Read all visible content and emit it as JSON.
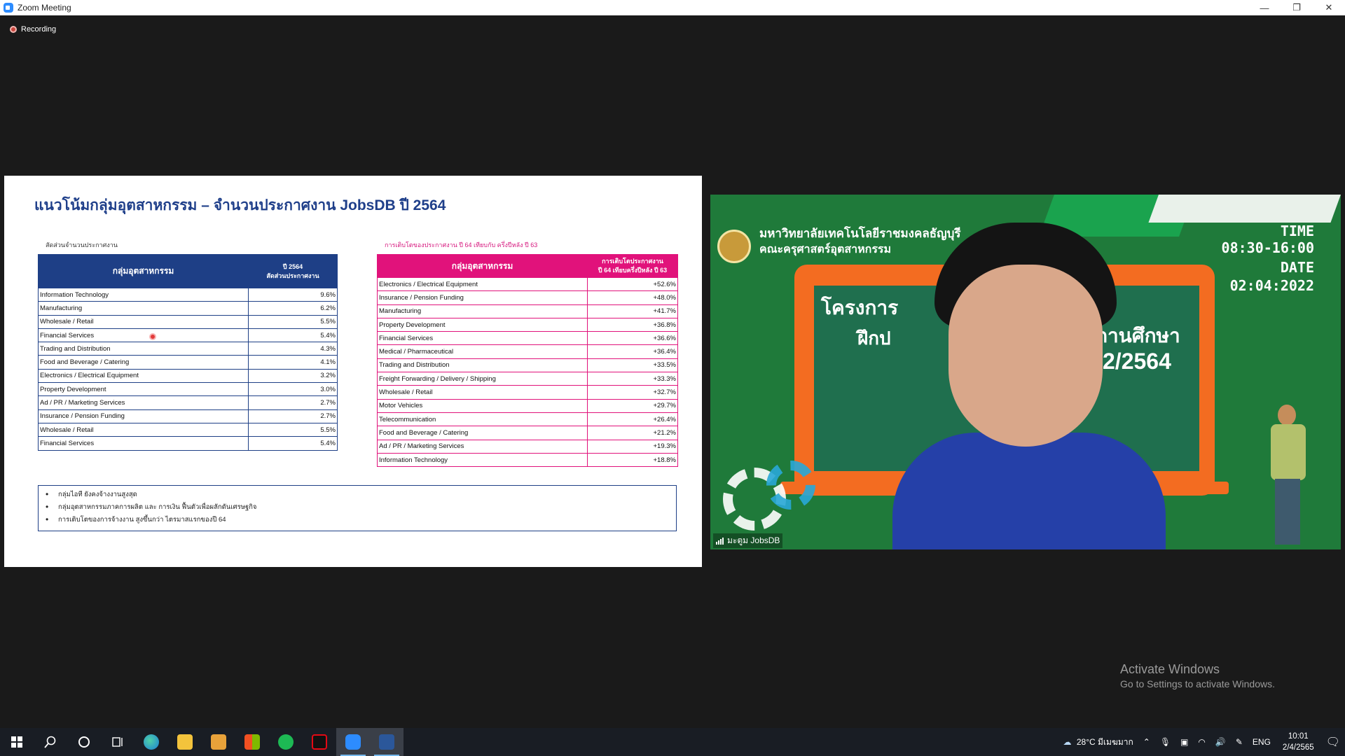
{
  "window": {
    "title": "Zoom Meeting",
    "minimize": "—",
    "maximize": "❐",
    "close": "✕"
  },
  "recording": {
    "label": "Recording"
  },
  "slide": {
    "title": "แนวโน้มกลุ่มอุตสาหกรรม – จำนวนประกาศงาน JobsDB ปี 2564",
    "left_subtitle": "สัดส่วนจำนวนประกาศงาน",
    "right_subtitle": "การเติบโตของประกาศงาน ปี 64 เทียบกับ ครึ่งปีหลัง ปี 63",
    "left_table": {
      "header_col1": "กลุ่มอุตสาหกรรม",
      "header_col2_line1": "ปี 2564",
      "header_col2_line2": "สัดส่วนประกาศงาน",
      "rows": [
        {
          "name": "Information Technology",
          "value": "9.6%"
        },
        {
          "name": "Manufacturing",
          "value": "6.2%"
        },
        {
          "name": "Wholesale / Retail",
          "value": "5.5%"
        },
        {
          "name": "Financial Services",
          "value": "5.4%"
        },
        {
          "name": "Trading and Distribution",
          "value": "4.3%"
        },
        {
          "name": "Food and Beverage / Catering",
          "value": "4.1%"
        },
        {
          "name": "Electronics / Electrical Equipment",
          "value": "3.2%"
        },
        {
          "name": "Property Development",
          "value": "3.0%"
        },
        {
          "name": "Ad / PR / Marketing Services",
          "value": "2.7%"
        },
        {
          "name": "Insurance / Pension Funding",
          "value": "2.7%"
        },
        {
          "name": "Wholesale / Retail",
          "value": "5.5%"
        },
        {
          "name": "Financial Services",
          "value": "5.4%"
        }
      ]
    },
    "right_table": {
      "header_col1": "กลุ่มอุตสาหกรรม",
      "header_col2_line1": "การเติบโตประกาศงาน",
      "header_col2_line2": "ปี 64 เทียบครึ่งปีหลัง ปี 63",
      "rows": [
        {
          "name": "Electronics / Electrical Equipment",
          "value": "+52.6%"
        },
        {
          "name": "Insurance / Pension Funding",
          "value": "+48.0%"
        },
        {
          "name": "Manufacturing",
          "value": "+41.7%"
        },
        {
          "name": "Property Development",
          "value": "+36.8%"
        },
        {
          "name": "Financial Services",
          "value": "+36.6%"
        },
        {
          "name": "Medical / Pharmaceutical",
          "value": "+36.4%"
        },
        {
          "name": "Trading and Distribution",
          "value": "+33.5%"
        },
        {
          "name": "Freight Forwarding / Delivery / Shipping",
          "value": "+33.3%"
        },
        {
          "name": "Wholesale / Retail",
          "value": "+32.7%"
        },
        {
          "name": "Motor Vehicles",
          "value": "+29.7%"
        },
        {
          "name": "Telecommunication",
          "value": "+26.4%"
        },
        {
          "name": "Food and Beverage / Catering",
          "value": "+21.2%"
        },
        {
          "name": "Ad / PR / Marketing Services",
          "value": "+19.3%"
        },
        {
          "name": "Information Technology",
          "value": "+18.8%"
        }
      ]
    },
    "notes": [
      "กลุ่มไอที ยังคงจ้างงานสูงสุด",
      "กลุ่มอุตสาหกรรมภาคการผลิต และ การเงิน ฟื้นตัวเพื่อผลักดันเศรษฐกิจ",
      "การเติบโตของการจ้างงาน สูงขึ้นกว่า ไตรมาสแรกของปี 64"
    ]
  },
  "video": {
    "university_line1": "มหาวิทยาลัยเทคโนโลยีราชมงคลธัญบุรี",
    "university_line2": "คณะครุศาสตร์อุตสาหกรรม",
    "time_label": "TIME",
    "time_value": "08:30-16:00",
    "date_label": "DATE",
    "date_value": "02:04:2022",
    "board_text1": "โครงการ",
    "board_text2": "ฝึกป",
    "board_text3": "ถานศึกษา",
    "board_text4": "2/2564",
    "participant_name": "มะตูม JobsDB"
  },
  "activate": {
    "line1": "Activate Windows",
    "line2": "Go to Settings to activate Windows."
  },
  "taskbar": {
    "weather": "28°C  มีเมฆมาก",
    "language": "ENG",
    "time": "10:01",
    "date": "2/4/2565"
  }
}
